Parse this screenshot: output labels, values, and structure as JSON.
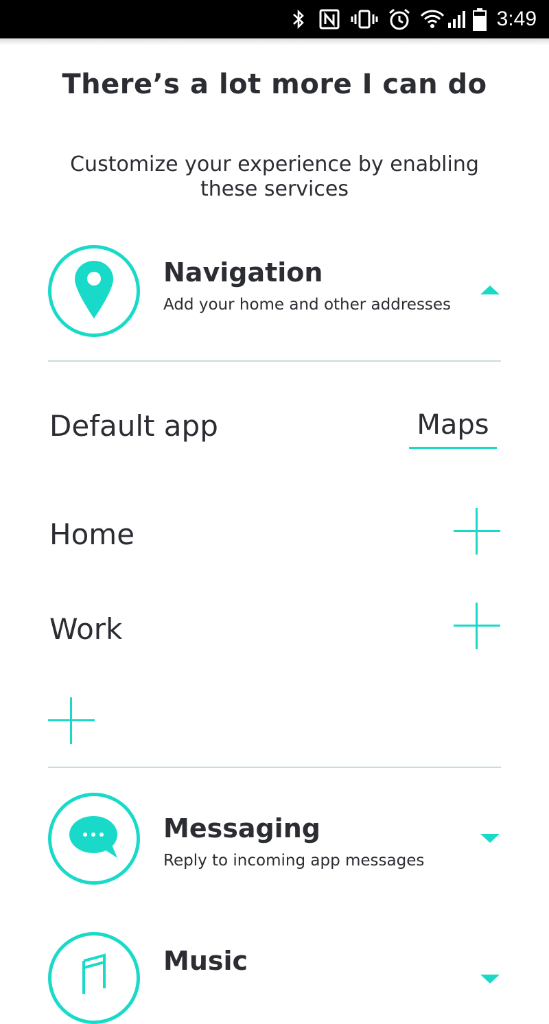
{
  "status_bar": {
    "time": "3:49",
    "icons": [
      "bluetooth-icon",
      "nfc-icon",
      "vibrate-icon",
      "alarm-icon",
      "wifi-icon",
      "signal-icon",
      "battery-icon"
    ]
  },
  "header": {
    "title": "There’s a lot more I can do",
    "subtitle": "Customize your experience by enabling these services"
  },
  "services": {
    "navigation": {
      "name": "Navigation",
      "description": "Add your home and other addresses",
      "expanded": true
    },
    "messaging": {
      "name": "Messaging",
      "description": "Reply to incoming app messages",
      "expanded": false
    },
    "music": {
      "name": "Music",
      "expanded": false
    }
  },
  "navigation_settings": {
    "default_app_label": "Default app",
    "default_app_value": "Maps",
    "home_label": "Home",
    "work_label": "Work"
  },
  "colors": {
    "accent": "#19dac9",
    "text": "#2b2d33",
    "divider": "#c5dedd",
    "status_bar": "#000000"
  }
}
